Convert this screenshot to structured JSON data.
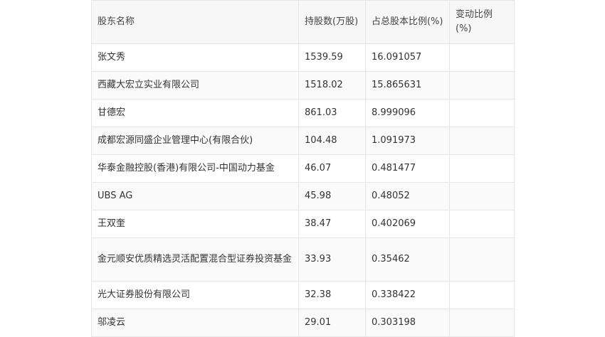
{
  "table": {
    "headers": [
      "股东名称",
      "持股数(万股)",
      "占总股本比例(%)",
      "变动比例(%)"
    ],
    "rows": [
      {
        "name": "张文秀",
        "shares": "1539.59",
        "ratio": "16.091057",
        "change": ""
      },
      {
        "name": "西藏大宏立实业有限公司",
        "shares": "1518.02",
        "ratio": "15.865631",
        "change": ""
      },
      {
        "name": "甘德宏",
        "shares": "861.03",
        "ratio": "8.999096",
        "change": ""
      },
      {
        "name": "成都宏源同盛企业管理中心(有限合伙)",
        "shares": "104.48",
        "ratio": "1.091973",
        "change": ""
      },
      {
        "name": "华泰金融控股(香港)有限公司-中国动力基金",
        "shares": "46.07",
        "ratio": "0.481477",
        "change": ""
      },
      {
        "name": "UBS AG",
        "shares": "45.98",
        "ratio": "0.48052",
        "change": ""
      },
      {
        "name": "王双奎",
        "shares": "38.47",
        "ratio": "0.402069",
        "change": ""
      },
      {
        "name": "金元顺安优质精选灵活配置混合型证券投资基金",
        "shares": "33.93",
        "ratio": "0.35462",
        "change": ""
      },
      {
        "name": "光大证券股份有限公司",
        "shares": "32.38",
        "ratio": "0.338422",
        "change": ""
      },
      {
        "name": "邬凌云",
        "shares": "29.01",
        "ratio": "0.303198",
        "change": ""
      }
    ]
  }
}
